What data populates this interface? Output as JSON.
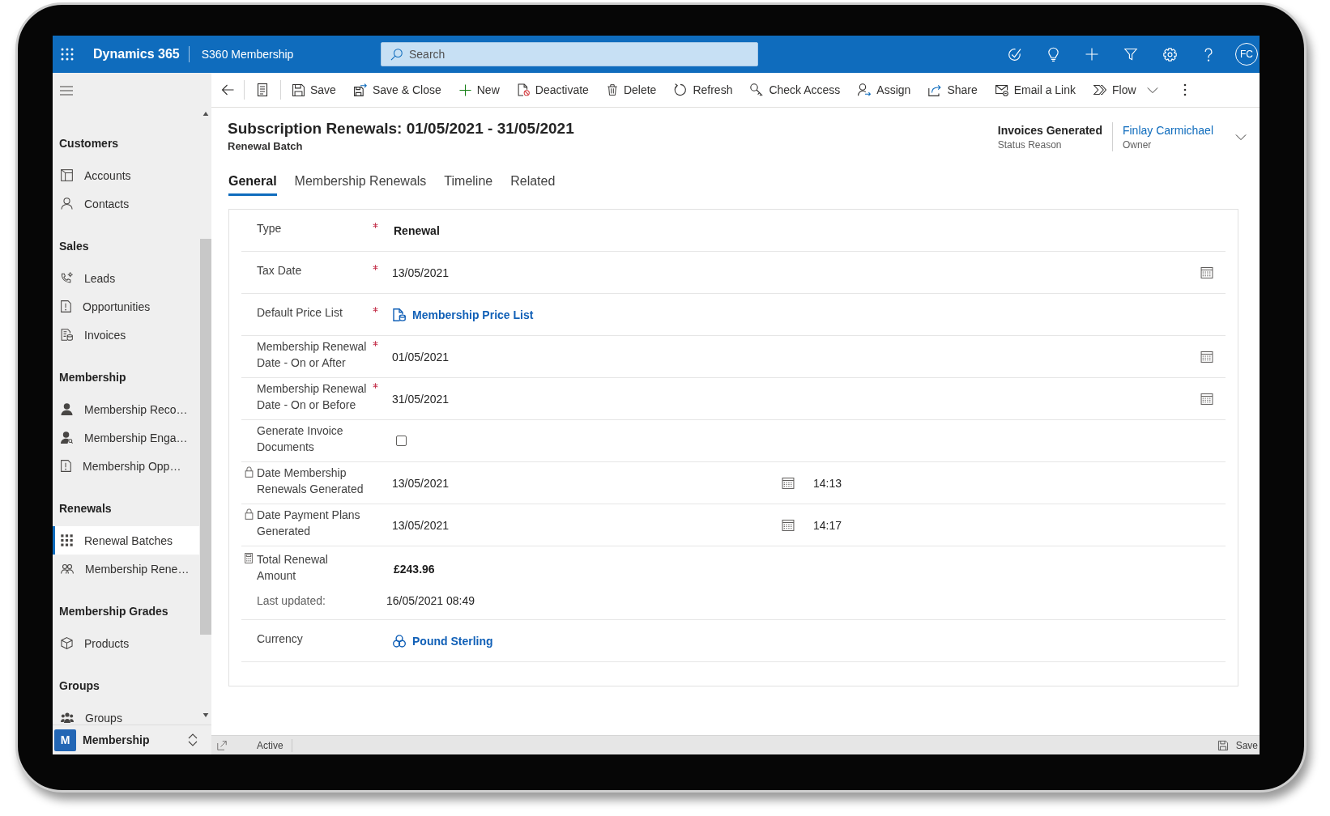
{
  "top_bar": {
    "app_name": "Dynamics 365",
    "area_name": "S360 Membership",
    "search": {
      "placeholder": "Search"
    },
    "user_initials": "FC"
  },
  "command_bar": {
    "commands": [
      {
        "label": "Save",
        "dropdown": false
      },
      {
        "label": "Save & Close",
        "dropdown": false
      },
      {
        "label": "New",
        "dropdown": false
      },
      {
        "label": "Deactivate",
        "dropdown": false
      },
      {
        "label": "Delete",
        "dropdown": false
      },
      {
        "label": "Refresh",
        "dropdown": false
      },
      {
        "label": "Check Access",
        "dropdown": false
      },
      {
        "label": "Assign",
        "dropdown": false
      },
      {
        "label": "Share",
        "dropdown": false
      },
      {
        "label": "Email a Link",
        "dropdown": false
      },
      {
        "label": "Flow",
        "dropdown": true
      }
    ]
  },
  "sidebar": {
    "groups": [
      {
        "title": "Customers",
        "items": [
          {
            "label": "Accounts",
            "selected": false
          },
          {
            "label": "Contacts",
            "selected": false
          }
        ]
      },
      {
        "title": "Sales",
        "items": [
          {
            "label": "Leads",
            "selected": false
          },
          {
            "label": "Opportunities",
            "selected": false
          },
          {
            "label": "Invoices",
            "selected": false
          }
        ]
      },
      {
        "title": "Membership",
        "items": [
          {
            "label": "Membership Reco…",
            "selected": false
          },
          {
            "label": "Membership Enga…",
            "selected": false
          },
          {
            "label": "Membership Opp…",
            "selected": false
          }
        ]
      },
      {
        "title": "Renewals",
        "items": [
          {
            "label": "Renewal Batches",
            "selected": true
          },
          {
            "label": "Membership Rene…",
            "selected": false
          }
        ]
      },
      {
        "title": "Membership Grades",
        "items": [
          {
            "label": "Products",
            "selected": false
          }
        ]
      },
      {
        "title": "Groups",
        "items": [
          {
            "label": "Groups",
            "selected": false
          }
        ]
      }
    ],
    "area_switcher": {
      "initial": "M",
      "label": "Membership"
    }
  },
  "record_header": {
    "title": "Subscription Renewals: 01/05/2021 - 31/05/2021",
    "entity": "Renewal Batch",
    "fields": [
      {
        "kind": "text",
        "value": "Invoices Generated",
        "label": "Status Reason"
      },
      {
        "kind": "link",
        "value": "Finlay Carmichael",
        "label": "Owner"
      }
    ]
  },
  "tabs": [
    {
      "label": "General",
      "selected": true
    },
    {
      "label": "Membership Renewals",
      "selected": false
    },
    {
      "label": "Timeline",
      "selected": false
    },
    {
      "label": "Related",
      "selected": false
    }
  ],
  "form": {
    "fields": [
      {
        "kind": "option",
        "label": "Type",
        "required": true,
        "locked": false,
        "value": "Renewal"
      },
      {
        "kind": "date",
        "label": "Tax Date",
        "required": true,
        "locked": false,
        "value": "13/05/2021"
      },
      {
        "kind": "lookup",
        "label": "Default Price List",
        "required": true,
        "locked": false,
        "value": "Membership Price List"
      },
      {
        "kind": "date",
        "label": "Membership Renewal Date - On or After",
        "required": true,
        "locked": false,
        "value": "01/05/2021"
      },
      {
        "kind": "date",
        "label": "Membership Renewal Date - On or Before",
        "required": true,
        "locked": false,
        "value": "31/05/2021"
      },
      {
        "kind": "checkbox",
        "label": "Generate Invoice Documents",
        "required": false,
        "locked": false,
        "checked": false
      },
      {
        "kind": "datetime",
        "label": "Date Membership Renewals Generated",
        "required": false,
        "locked": true,
        "value": "13/05/2021",
        "time": "14:13"
      },
      {
        "kind": "datetime",
        "label": "Date Payment Plans Generated",
        "required": false,
        "locked": true,
        "value": "13/05/2021",
        "time": "14:17"
      },
      {
        "kind": "calculated",
        "label": "Total Renewal Amount",
        "required": false,
        "locked": false,
        "value": "£243.96",
        "updated_label": "Last updated:",
        "updated_value": "16/05/2021 08:49"
      },
      {
        "kind": "lookup",
        "label": "Currency",
        "required": false,
        "locked": false,
        "value": "Pound Sterling"
      }
    ]
  },
  "status_bar": {
    "status": "Active",
    "save_label": "Save"
  }
}
